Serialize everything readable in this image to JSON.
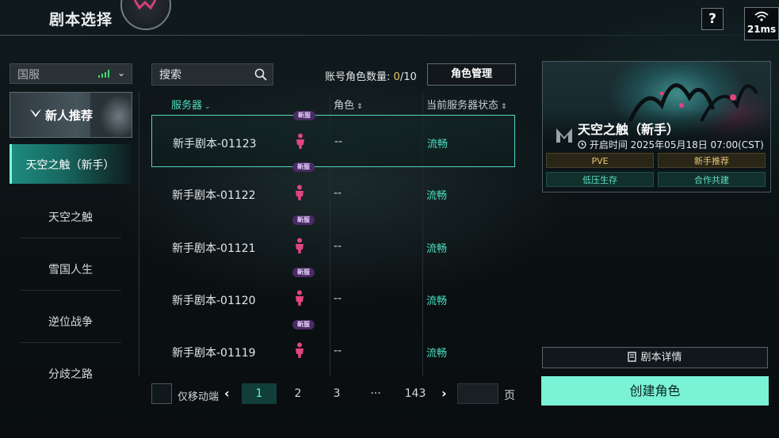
{
  "header": {
    "title": "剧本选择",
    "help_label": "?",
    "latency": "21ms"
  },
  "server_select": {
    "label": "国服"
  },
  "sidebar": {
    "featured": "新人推荐",
    "items": [
      {
        "label": "天空之触（新手）",
        "active": true
      },
      {
        "label": "天空之触"
      },
      {
        "label": "雪国人生"
      },
      {
        "label": "逆位战争"
      },
      {
        "label": "分歧之路"
      }
    ]
  },
  "search": {
    "placeholder": "搜索"
  },
  "account": {
    "label": "账号角色数量:",
    "current": "0",
    "max": "/10",
    "manage_label": "角色管理"
  },
  "table": {
    "headers": {
      "server": "服务器",
      "role": "角色",
      "status": "当前服务器状态"
    },
    "rows": [
      {
        "name": "新手剧本-01123",
        "badge": "新服",
        "role": "--",
        "status": "流畅"
      },
      {
        "name": "新手剧本-01122",
        "badge": "新服",
        "role": "--",
        "status": "流畅"
      },
      {
        "name": "新手剧本-01121",
        "badge": "新服",
        "role": "--",
        "status": "流畅"
      },
      {
        "name": "新手剧本-01120",
        "badge": "新服",
        "role": "--",
        "status": "流畅"
      },
      {
        "name": "新手剧本-01119",
        "badge": "新服",
        "role": "--",
        "status": "流畅"
      }
    ]
  },
  "pagination": {
    "mobile_only_label": "仅移动端",
    "pages": [
      "1",
      "2",
      "3",
      "···",
      "143"
    ],
    "current": "1",
    "page_unit": "页"
  },
  "detail_card": {
    "title": "天空之触（新手）",
    "time": "开启时间 2025年05月18日 07:00(CST)",
    "tags": [
      "PVE",
      "新手推荐",
      "低压生存",
      "合作共建"
    ]
  },
  "buttons": {
    "detail": "剧本详情",
    "create": "创建角色"
  },
  "colors": {
    "accent": "#4be0c0",
    "primary_button": "#79f2d6",
    "badge": "#4a2a63"
  }
}
